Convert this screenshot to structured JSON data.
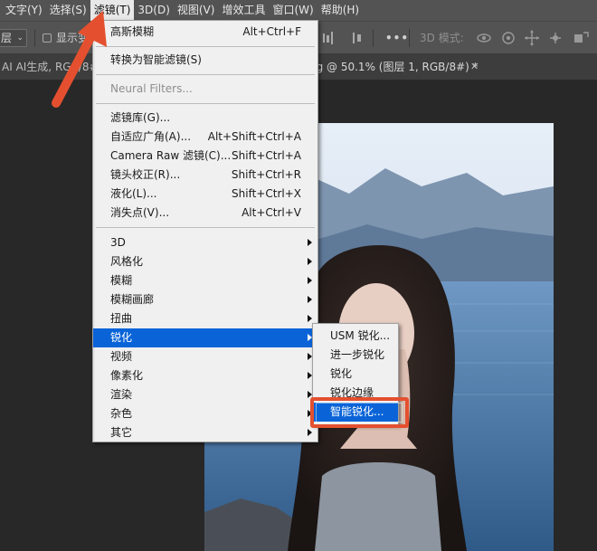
{
  "menubar": {
    "items": [
      {
        "label": "文字(Y)"
      },
      {
        "label": "选择(S)"
      },
      {
        "label": "滤镜(T)"
      },
      {
        "label": "3D(D)"
      },
      {
        "label": "视图(V)"
      },
      {
        "label": "增效工具"
      },
      {
        "label": "窗口(W)"
      },
      {
        "label": "帮助(H)"
      }
    ]
  },
  "options_bar": {
    "layer_dropdown": "层",
    "show_transform_label": "显示变",
    "mode_3d_label": "3D 模式:",
    "more_label": "•••"
  },
  "tabs": {
    "doc1_label": "AI AI生成, RGB/8#)",
    "doc2_label": "ng @ 50.1% (图层 1, RGB/8#) *",
    "close_glyph": "✕"
  },
  "filter_menu": {
    "last_filter": {
      "label": "高斯模糊",
      "shortcut": "Alt+Ctrl+F"
    },
    "smart": {
      "label": "转换为智能滤镜(S)"
    },
    "neural": {
      "label": "Neural Filters..."
    },
    "gallery": {
      "label": "滤镜库(G)..."
    },
    "adaptive_wide": {
      "label": "自适应广角(A)...",
      "shortcut": "Alt+Shift+Ctrl+A"
    },
    "camera_raw": {
      "label": "Camera Raw 滤镜(C)...",
      "shortcut": "Shift+Ctrl+A"
    },
    "lens_correction": {
      "label": "镜头校正(R)...",
      "shortcut": "Shift+Ctrl+R"
    },
    "liquify": {
      "label": "液化(L)...",
      "shortcut": "Shift+Ctrl+X"
    },
    "vanishing_point": {
      "label": "消失点(V)...",
      "shortcut": "Alt+Ctrl+V"
    },
    "submenus": [
      {
        "label": "3D"
      },
      {
        "label": "风格化"
      },
      {
        "label": "模糊"
      },
      {
        "label": "模糊画廊"
      },
      {
        "label": "扭曲"
      },
      {
        "label": "锐化"
      },
      {
        "label": "视频"
      },
      {
        "label": "像素化"
      },
      {
        "label": "渲染"
      },
      {
        "label": "杂色"
      },
      {
        "label": "其它"
      }
    ]
  },
  "sharpen_submenu": {
    "items": [
      {
        "label": "USM 锐化..."
      },
      {
        "label": "进一步锐化"
      },
      {
        "label": "锐化"
      },
      {
        "label": "锐化边缘"
      },
      {
        "label": "智能锐化..."
      }
    ]
  },
  "colors": {
    "highlight": "#0a64d8",
    "annotation_red": "#e4502f",
    "menubar_bg": "#535353"
  }
}
